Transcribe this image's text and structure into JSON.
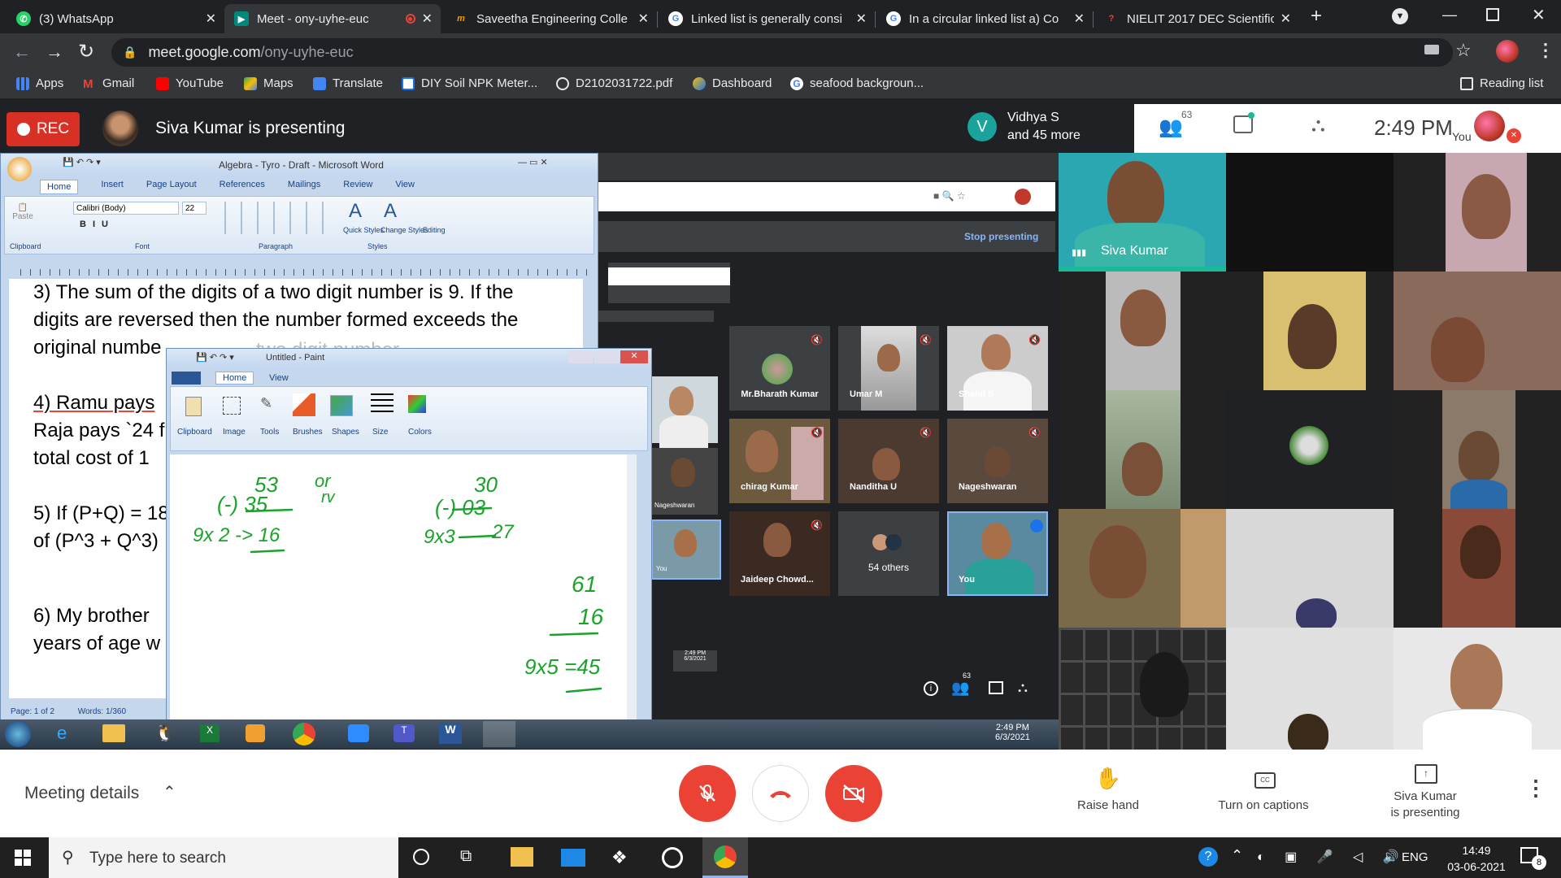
{
  "browser": {
    "tabs": [
      {
        "title": "(3) WhatsApp",
        "active": false
      },
      {
        "title": "Meet - ony-uyhe-euc",
        "active": true
      },
      {
        "title": "Saveetha Engineering Colle",
        "active": false
      },
      {
        "title": "Linked list is generally consi",
        "active": false
      },
      {
        "title": "In a circular linked list a) Co",
        "active": false
      },
      {
        "title": "NIELIT 2017 DEC Scientific A",
        "active": false
      }
    ],
    "url_host": "meet.google.com",
    "url_path": "/ony-uyhe-euc",
    "bookmarks": [
      "Apps",
      "Gmail",
      "YouTube",
      "Maps",
      "Translate",
      "DIY Soil NPK Meter...",
      "D2102031722.pdf",
      "Dashboard",
      "seafood backgroun..."
    ],
    "reading_list": "Reading list"
  },
  "meet": {
    "rec_label": "REC",
    "presenting_banner": "Siva Kumar is presenting",
    "participant_card": {
      "initial": "V",
      "line1": "Vidhya S",
      "line2": "and 45 more"
    },
    "people_count": "63",
    "clock": "2:49  PM",
    "you_label": "You",
    "meeting_details": "Meeting details",
    "raise_hand": "Raise hand",
    "captions": "Turn on captions",
    "presenter_line1": "Siva Kumar",
    "presenter_line2": "is presenting",
    "tiles": {
      "speaker_name": "Siva Kumar"
    }
  },
  "shared_screen": {
    "word": {
      "title": "Algebra - Tyro - Draft - Microsoft Word",
      "ribbon_tabs": [
        "Home",
        "Insert",
        "Page Layout",
        "References",
        "Mailings",
        "Review",
        "View"
      ],
      "font_name": "Calibri (Body)",
      "font_size": "22",
      "groups": [
        "Clipboard",
        "Font",
        "Paragraph",
        "Styles"
      ],
      "styles_labels": [
        "Quick Styles",
        "Change Styles",
        "Editing"
      ],
      "lines": [
        "3) The sum of the digits of a two digit number  is 9. If the",
        "digits are reversed then the number formed exceeds the",
        "original numbe",
        "4) Ramu pays",
        "Raja pays `24 f",
        "total cost of 1",
        "5) If (P+Q) = 18",
        "of (P^3 + Q^3)",
        "6) My brother",
        "years of age w"
      ],
      "status_page": "Page: 1 of 2",
      "status_words": "Words: 1/360",
      "ruler_ghost": "two digit number"
    },
    "paint": {
      "title": "Untitled - Paint",
      "tabs": [
        "Home",
        "View"
      ],
      "tools": [
        "Clipboard",
        "Image",
        "Tools",
        "Brushes",
        "Shapes",
        "Size",
        "Colors"
      ],
      "handwriting": {
        "left": [
          "53",
          "or",
          "(-) 35",
          "rv",
          "9x 2 -> 16"
        ],
        "right": [
          "30",
          "(-) 03",
          "9x3",
          "27",
          "61",
          "16",
          "9x5 =45"
        ]
      }
    },
    "nested_meet": {
      "stop_presenting": "Stop presenting",
      "tiles": [
        "Mr.Bharath Kumar",
        "Umar M",
        "Shahil S",
        "chirag Kumar",
        "Nanditha U",
        "Nageshwaran",
        "Jaideep Chowd...",
        "54 others",
        "You"
      ],
      "inner_small_tiles": [
        "Nageshwaran",
        "You"
      ],
      "people_count": "63",
      "inner_time": "2:49 PM",
      "inner_date": "6/3/2021"
    },
    "win7_taskbar": {
      "time": "2:49 PM",
      "date": "6/3/2021"
    }
  },
  "windows_taskbar": {
    "search_placeholder": "Type here to search",
    "lang": "ENG",
    "time": "14:49",
    "date": "03-06-2021",
    "notif_count": "8"
  },
  "colors": {
    "rec": "#d93025",
    "meet_red": "#ea4335",
    "accent_blue": "#8ab4f8",
    "ink_green": "#1aa32a",
    "tile_teal": "#1bb99a"
  }
}
